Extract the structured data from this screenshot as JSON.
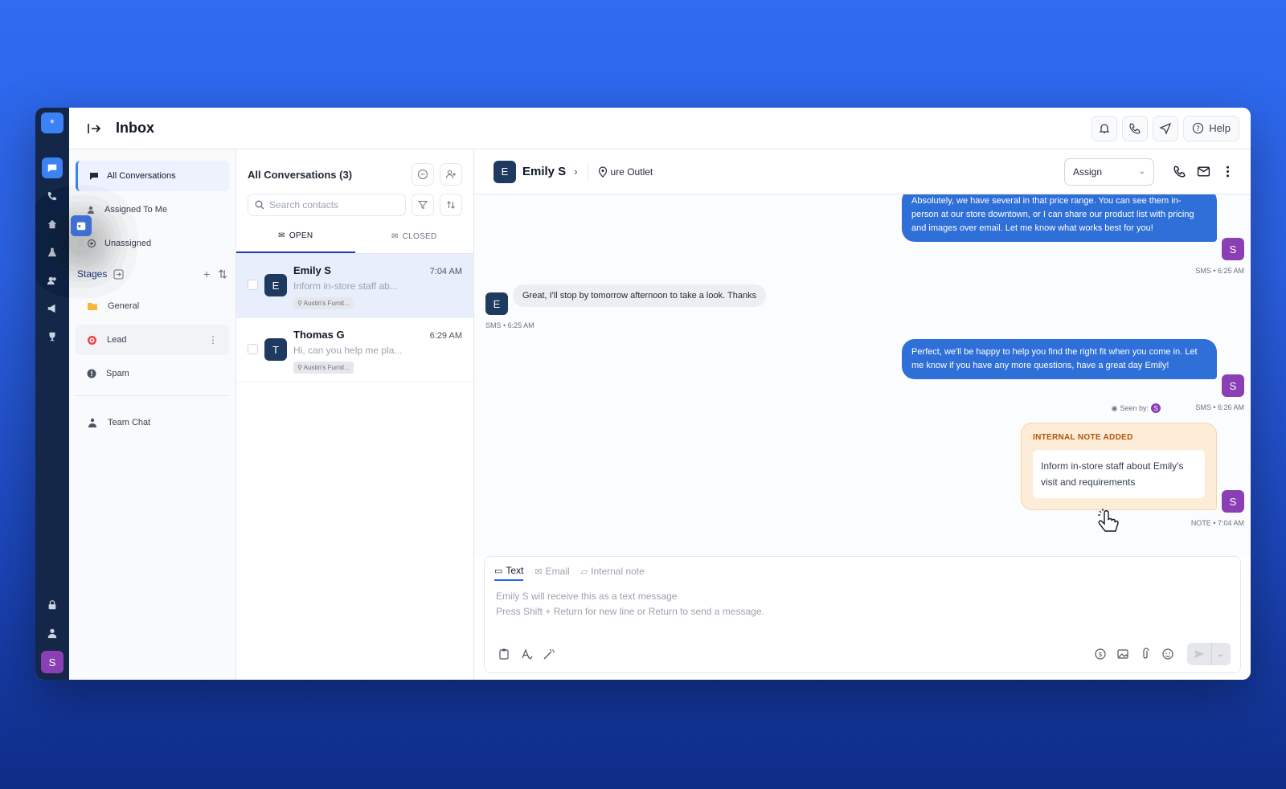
{
  "header": {
    "title": "Inbox",
    "help_label": "Help"
  },
  "rail": {
    "avatar_initial": "S",
    "logo": "*"
  },
  "sidebar": {
    "items": [
      {
        "label": "All Conversations"
      },
      {
        "label": "Assigned To Me"
      },
      {
        "label": "Unassigned"
      }
    ],
    "stages_label": "Stages",
    "stages": [
      {
        "label": "General"
      },
      {
        "label": "Lead"
      },
      {
        "label": "Spam"
      }
    ],
    "team_chat_label": "Team Chat"
  },
  "list": {
    "title": "All Conversations (3)",
    "search_placeholder": "Search contacts",
    "tab_open": "OPEN",
    "tab_closed": "CLOSED",
    "conversations": [
      {
        "initial": "E",
        "name": "Emily S",
        "time": "7:04 AM",
        "preview": "Inform in-store staff ab...",
        "tag": "Austin's Furnit..."
      },
      {
        "initial": "T",
        "name": "Thomas G",
        "time": "6:29 AM",
        "preview": "Hi, can you help me pla...",
        "tag": "Austin's Furnit..."
      }
    ]
  },
  "chat": {
    "contact_initial": "E",
    "contact_name": "Emily S",
    "location": "ure Outlet",
    "assign_label": "Assign",
    "messages": {
      "m1_text": "Absolutely, we have several in that price range. You can see them in-person at our store downtown, or I can share our product list with pricing and images over email. Let me know what works best for you!",
      "m1_meta": "SMS • 6:25 AM",
      "m2_text": "Great, I'll stop by tomorrow afternoon to take a look. Thanks",
      "m2_meta": "SMS • 6:25 AM",
      "m3_text": "Perfect, we'll be happy to help you find the right fit when you come in. Let me know if you have any more questions, have a great day Emily!",
      "m3_seen": "Seen by:",
      "m3_meta": "SMS • 6:26 AM",
      "note_header": "INTERNAL NOTE ADDED",
      "note_body": "Inform in-store staff about Emily's visit and requirements",
      "note_meta": "NOTE • 7:04 AM",
      "agent_initial": "S",
      "contact_initial": "E"
    },
    "composer": {
      "tab_text": "Text",
      "tab_email": "Email",
      "tab_note": "Internal note",
      "placeholder_line1": "Emily S will receive this as a text message",
      "placeholder_line2": "Press Shift + Return for new line or Return to send a message."
    }
  },
  "colors": {
    "accent": "#2f6fd8",
    "rail": "#142748",
    "agent": "#8b3fb5",
    "note": "#fdecd7"
  }
}
